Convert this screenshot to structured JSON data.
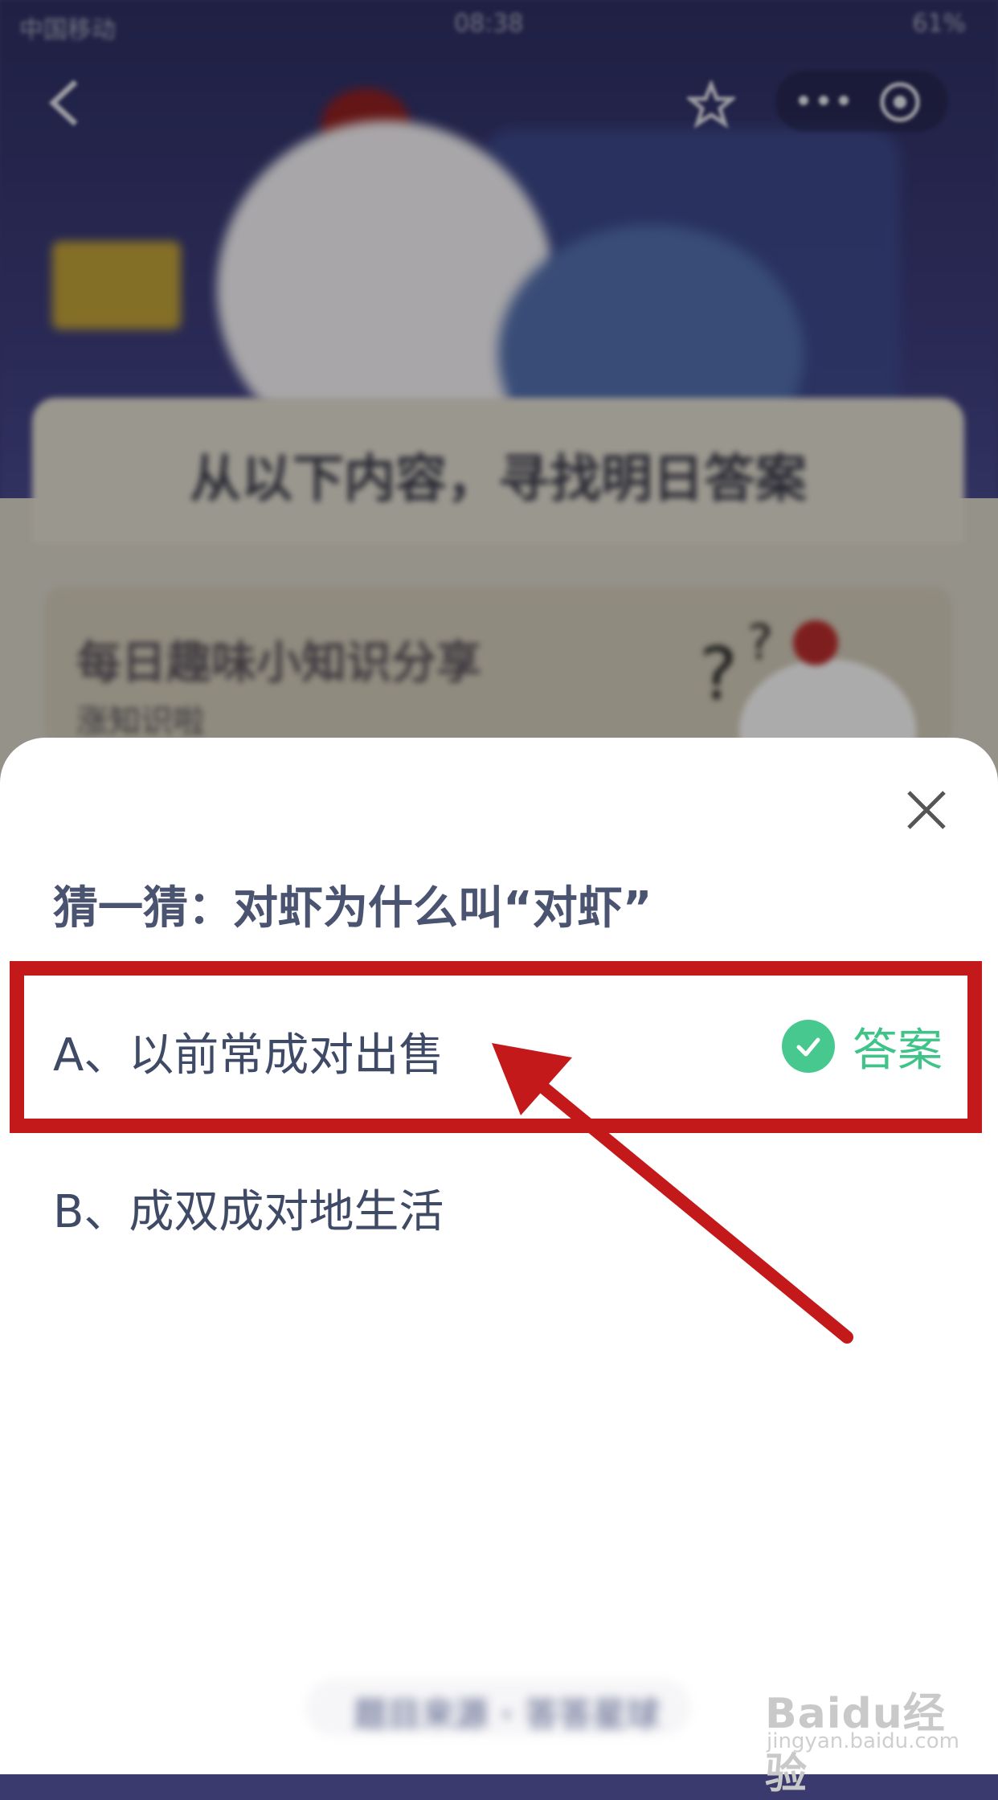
{
  "status_bar": {
    "carrier": "中国移动",
    "time": "08:38",
    "battery": "61%"
  },
  "background": {
    "banner_title": "从以下内容，寻找明日答案",
    "card_title": "每日趣味小知识分享",
    "card_subtitle": "涨知识啦"
  },
  "quiz": {
    "question": "猜一猜：对虾为什么叫“对虾”",
    "options": [
      {
        "text": "A、以前常成对出售",
        "is_answer": true
      },
      {
        "text": "B、成双成对地生活",
        "is_answer": false
      }
    ],
    "answer_label": "答案"
  },
  "footer": {
    "text": "题目来源 · 答答星球"
  },
  "watermark": {
    "brand": "Baidu经验",
    "url": "jingyan.baidu.com"
  },
  "colors": {
    "highlight": "#c3191b",
    "answer_green": "#3fc389",
    "question_text": "#4a5470"
  }
}
